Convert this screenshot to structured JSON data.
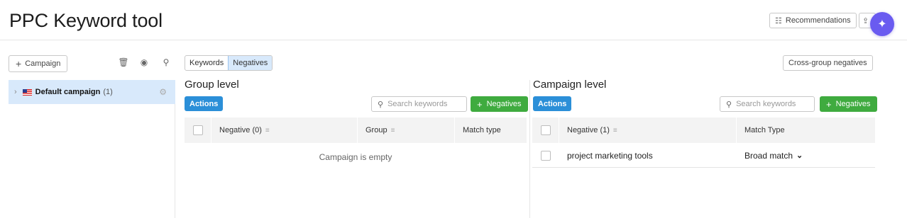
{
  "page": {
    "title": "PPC Keyword tool"
  },
  "header": {
    "recommendations_label": "Recommendations",
    "ai_icon": "sparkle-icon",
    "export_icon": "upload-icon"
  },
  "sidebar": {
    "add_campaign_label": "Campaign",
    "tools": [
      "trash-icon",
      "eye-icon",
      "search-icon"
    ],
    "campaigns": [
      {
        "name": "Default campaign",
        "count": "(1)",
        "flag": "us-flag-icon",
        "selected": true
      }
    ]
  },
  "view_toggle": {
    "options": [
      "Keywords",
      "Negatives"
    ],
    "active": "Negatives"
  },
  "cross_group_label": "Cross-group negatives",
  "group_level": {
    "title": "Group level",
    "actions_label": "Actions",
    "search_placeholder": "Search keywords",
    "add_label": "Negatives",
    "columns": {
      "negative": "Negative (0)",
      "group": "Group",
      "match": "Match type"
    },
    "empty_text": "Campaign is empty"
  },
  "campaign_level": {
    "title": "Campaign level",
    "actions_label": "Actions",
    "search_placeholder": "Search keywords",
    "add_label": "Negatives",
    "columns": {
      "negative": "Negative (1)",
      "match": "Match Type"
    },
    "rows": [
      {
        "keyword": "project marketing tools",
        "match_type": "Broad match"
      }
    ]
  },
  "colors": {
    "primary": "#2b8fd8",
    "success": "#3fab3f",
    "selected": "#d8e9fb",
    "ai": "#6a5bf0"
  }
}
